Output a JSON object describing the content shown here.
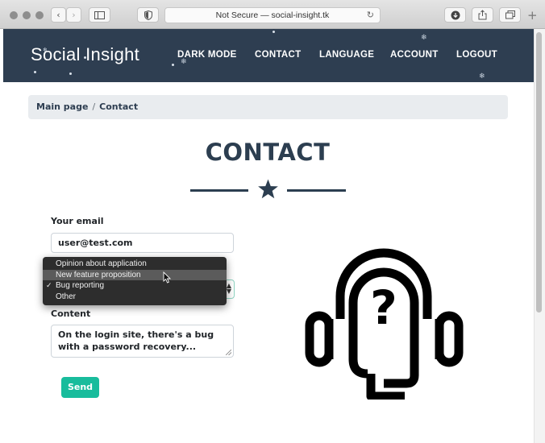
{
  "browser": {
    "url_text": "Not Secure — social-insight.tk",
    "reload_icon": "reload-icon",
    "new_tab_symbol": "+"
  },
  "nav": {
    "brand": "Social Insight",
    "links": [
      "DARK MODE",
      "CONTACT",
      "LANGUAGE",
      "ACCOUNT",
      "LOGOUT"
    ]
  },
  "breadcrumb": {
    "home": "Main page",
    "separator": "/",
    "current": "Contact"
  },
  "page": {
    "title": "CONTACT",
    "divider_icon": "star-icon"
  },
  "form": {
    "email_label": "Your email",
    "email_value": "user@test.com",
    "subject_options": [
      "Opinion about application",
      "New feature proposition",
      "Bug reporting",
      "Other"
    ],
    "subject_selected": "Bug reporting",
    "subject_hovered": "New feature proposition",
    "content_label": "Content",
    "content_value": "On the login site, there's a bug with a password recovery...",
    "send_label": "Send"
  },
  "illustration": {
    "icon": "customer-support-headset-icon",
    "glyph": "?"
  },
  "colors": {
    "navbar": "#2e3e51",
    "heading": "#2c3e50",
    "accent": "#18bc9c",
    "breadcrumb_bg": "#e9ecef"
  }
}
